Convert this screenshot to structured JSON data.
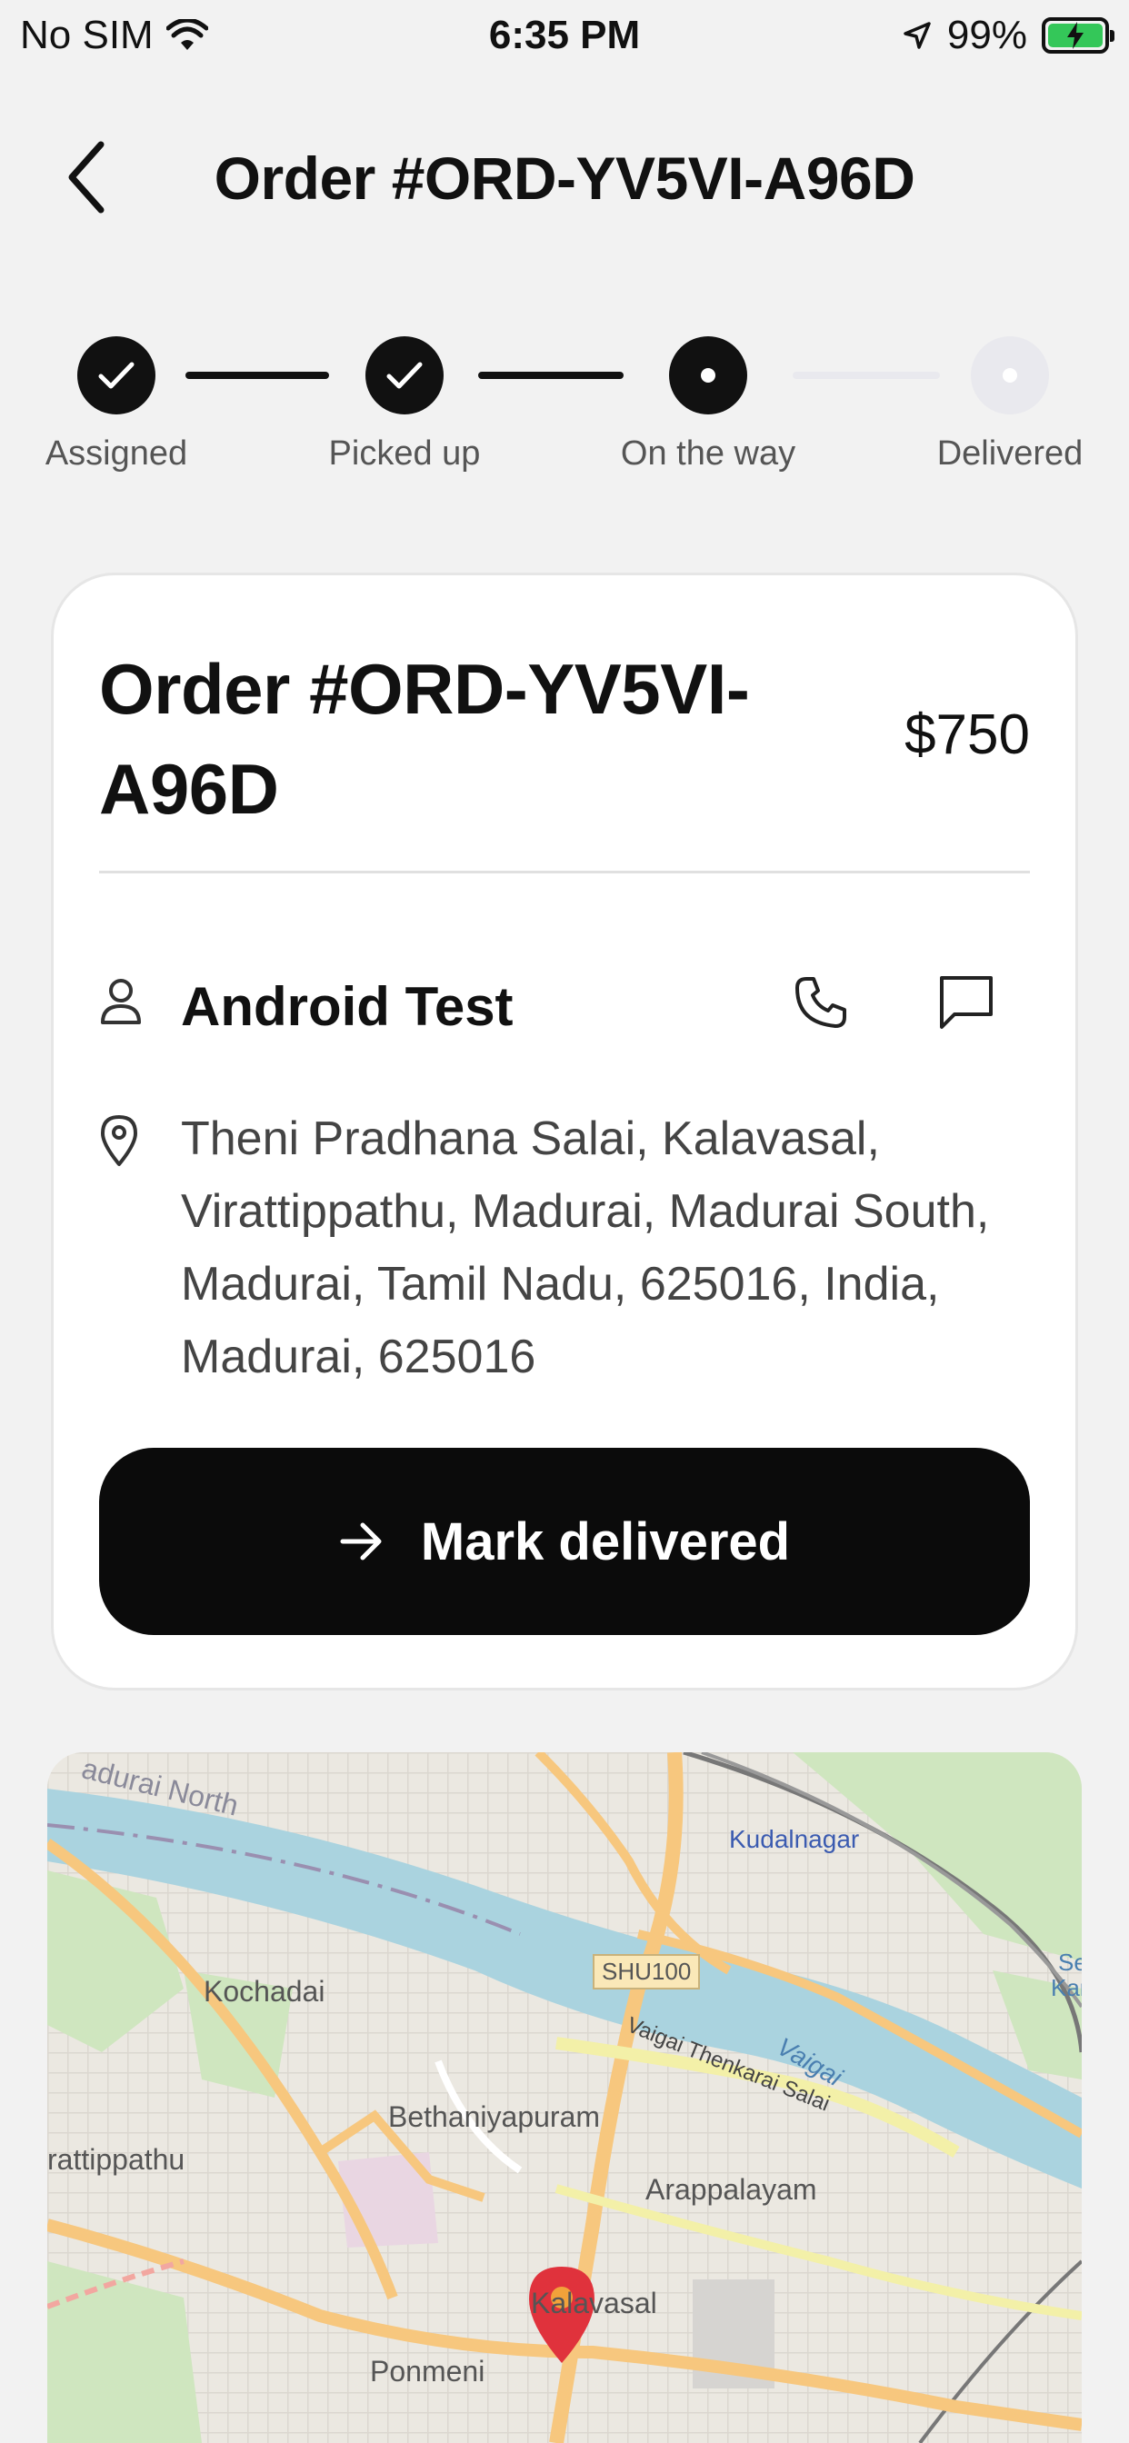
{
  "status_bar": {
    "carrier": "No SIM",
    "time": "6:35 PM",
    "battery": "99%"
  },
  "header": {
    "title": "Order #ORD-YV5VI-A96D",
    "back_icon": "chevron-left-icon"
  },
  "stepper": {
    "steps": [
      {
        "label": "Assigned",
        "state": "done"
      },
      {
        "label": "Picked up",
        "state": "done"
      },
      {
        "label": "On the way",
        "state": "current"
      },
      {
        "label": "Delivered",
        "state": "pending"
      }
    ]
  },
  "order": {
    "title": "Order #ORD-YV5VI-A96D",
    "price": "$750",
    "customer_name": "Android Test",
    "address": "Theni Pradhana Salai, Kalavasal, Virattippathu, Madurai, Madurai South, Madurai, Tamil Nadu, 625016, India, Madurai, 625016",
    "action_label": "Mark delivered"
  },
  "map": {
    "labels": {
      "madurai_north": "adurai North",
      "kudalnagar": "Kudalnagar",
      "kochadai": "Kochadai",
      "shu100": "SHU100",
      "vaigai_road": "Vaigai Thenkarai Salai",
      "vaigai": "Vaigai",
      "bethaniyapuram": "Bethaniyapuram",
      "rattippathu": "rattippathu",
      "arappalayam": "Arappalayam",
      "kalavasal": "Kalavasal",
      "ponmeni": "Ponmeni",
      "se": "Se",
      "kar": "Kar"
    }
  },
  "colors": {
    "accent": "#0b0b0b",
    "pin": "#e0323c",
    "battery": "#34c759",
    "inactive": "#e9e9ee"
  }
}
